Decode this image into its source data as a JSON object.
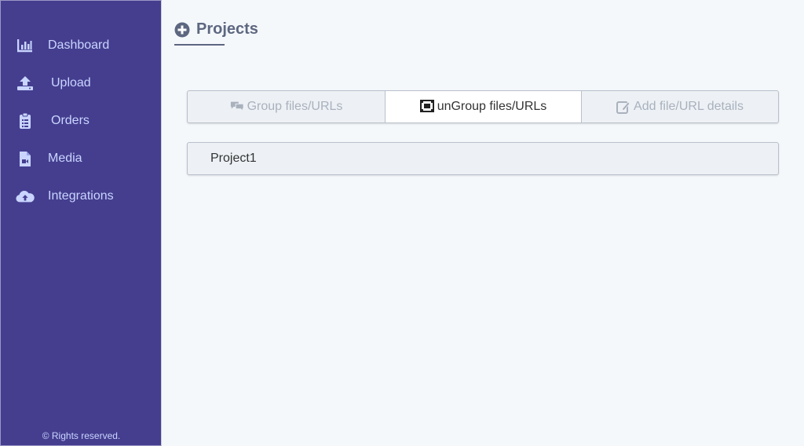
{
  "sidebar": {
    "items": [
      {
        "label": "Dashboard",
        "icon": "chart-bar-icon"
      },
      {
        "label": "Upload",
        "icon": "upload-icon"
      },
      {
        "label": "Orders",
        "icon": "clipboard-list-icon"
      },
      {
        "label": "Media",
        "icon": "file-video-icon"
      },
      {
        "label": "Integrations",
        "icon": "cloud-upload-icon"
      }
    ],
    "footer": "© Rights reserved."
  },
  "header": {
    "title": "Projects",
    "icon": "plus-circle-icon"
  },
  "tabs": [
    {
      "label": "Group files/URLs",
      "icon": "comments-icon",
      "active": false
    },
    {
      "label": "unGroup files/URLs",
      "icon": "object-ungroup-icon",
      "active": true
    },
    {
      "label": "Add file/URL details",
      "icon": "edit-icon",
      "active": false
    }
  ],
  "projects": [
    {
      "name": "Project1"
    }
  ],
  "colors": {
    "sidebar_bg": "#453e8f",
    "sidebar_text": "#c9d5ff",
    "page_bg": "#f5f8fb",
    "title": "#5d6780"
  }
}
